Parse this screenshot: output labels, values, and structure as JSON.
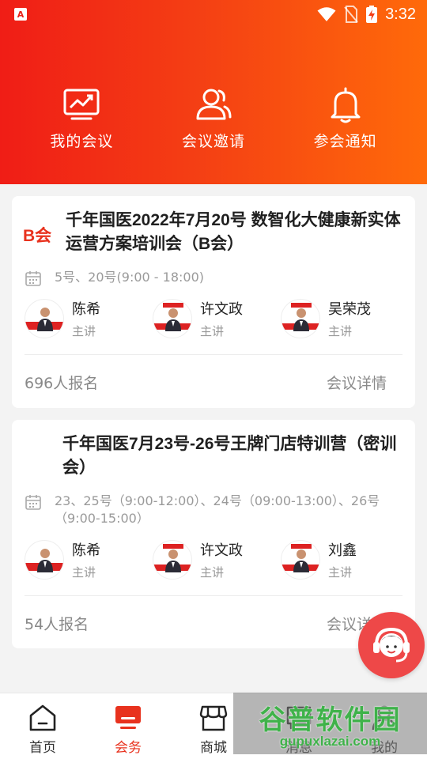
{
  "status_bar": {
    "app_badge": "A",
    "time": "3:32"
  },
  "quick_nav": [
    {
      "label": "我的会议",
      "icon": "presentation-chart-icon"
    },
    {
      "label": "会议邀请",
      "icon": "users-icon"
    },
    {
      "label": "参会通知",
      "icon": "bell-icon"
    }
  ],
  "meetings": [
    {
      "badge": "B会",
      "title": "千年国医2022年7月20号 数智化大健康新实体运营方案培训会（B会）",
      "dates": "5号、20号(9:00 - 18:00)",
      "speakers": [
        {
          "name": "陈希",
          "role": "主讲"
        },
        {
          "name": "许文政",
          "role": "主讲"
        },
        {
          "name": "吴荣茂",
          "role": "主讲"
        }
      ],
      "signup": "696人报名",
      "detail_link": "会议详情"
    },
    {
      "badge": "",
      "title": "千年国医7月23号-26号王牌门店特训营（密训会）",
      "dates": "23、25号（9:00-12:00）、24号（09:00-13:00）、26号（9:00-15:00）",
      "speakers": [
        {
          "name": "陈希",
          "role": "主讲"
        },
        {
          "name": "许文政",
          "role": "主讲"
        },
        {
          "name": "刘鑫",
          "role": "主讲"
        }
      ],
      "signup": "54人报名",
      "detail_link": "会议详情"
    }
  ],
  "tabs": [
    {
      "label": "首页",
      "icon": "home-icon",
      "active": false
    },
    {
      "label": "会务",
      "icon": "monitor-icon",
      "active": true
    },
    {
      "label": "商城",
      "icon": "store-icon",
      "active": false
    },
    {
      "label": "消息",
      "icon": "message-icon",
      "active": false
    },
    {
      "label": "我的",
      "icon": "user-icon",
      "active": false
    }
  ],
  "watermark": {
    "main": "谷普软件园",
    "sub": "gupuxlazai.com"
  },
  "colors": {
    "header_start": "#f01d16",
    "header_end": "#ff6a0a",
    "accent": "#e8321e",
    "fab": "#ee4848"
  }
}
